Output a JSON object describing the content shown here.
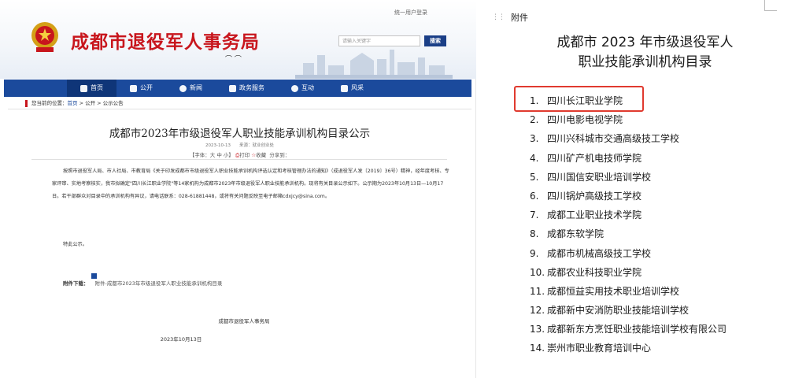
{
  "website": {
    "top_links": "统一用户登录",
    "site_title": "成都市退役军人事务局",
    "search": {
      "placeholder": "请输入关键字",
      "button": "搜索"
    },
    "nav": [
      {
        "label": "首页",
        "icon": "home-icon"
      },
      {
        "label": "公开",
        "icon": "calendar-icon"
      },
      {
        "label": "新闻",
        "icon": "globe-icon"
      },
      {
        "label": "政务服务",
        "icon": "person-icon"
      },
      {
        "label": "互动",
        "icon": "chat-icon"
      },
      {
        "label": "风采",
        "icon": "badge-icon"
      }
    ],
    "breadcrumb": {
      "prefix": "您当前的位置：",
      "home": "首页",
      "rest": " > 公开 > 公示公告"
    },
    "article": {
      "title": "成都市2023年市级退役军人职业技能承训机构目录公示",
      "meta": "2023-10-13　　来源：就业创业处",
      "tools": {
        "font": "【字体：大 中 小】",
        "print": "打印",
        "favorite": "收藏",
        "share": "分享到："
      },
      "paragraph_1": "按照市退役军人局、市人社局、市教育局《关于印发成都市市级退役军人职业技能承训机构评选认定和考核管理办法的通知》（成退役军人发〔2019〕36号）精神，经年度考核、专家评审、实地考察核实，我市拟确定\"四川长江职业学院\"等14家机构为成都市2023年市级退役军人职业技能承训机构。现将有关目录公示如下。公示期为2023年10月13日—10月17日。若干部群众对目录中的承训机构有异议，请电话联系：028-61881448，或将有关问题反映至电子邮箱cdxjcy@sina.com。",
      "paragraph_2": "特此公示。",
      "attachment_label": "附件下载：",
      "attachment_link": "附件-成都市2023年市级退役军人职业技能承训机构目录",
      "signature_org": "成都市退役军人事务局",
      "signature_date": "2023年10月13日"
    }
  },
  "document": {
    "label": "附件",
    "title_line1": "成都市 2023 年市级退役军人",
    "title_line2": "职业技能承训机构目录",
    "items": [
      {
        "num": "1.",
        "name": "四川长江职业学院"
      },
      {
        "num": "2.",
        "name": "四川电影电视学院"
      },
      {
        "num": "3.",
        "name": "四川兴科城市交通高级技工学校"
      },
      {
        "num": "4.",
        "name": "四川矿产机电技师学院"
      },
      {
        "num": "5.",
        "name": "四川国信安职业培训学校"
      },
      {
        "num": "6.",
        "name": "四川锅炉高级技工学校"
      },
      {
        "num": "7.",
        "name": "成都工业职业技术学院"
      },
      {
        "num": "8.",
        "name": "成都东软学院"
      },
      {
        "num": "9.",
        "name": "成都市机械高级技工学校"
      },
      {
        "num": "10.",
        "name": "成都农业科技职业学院"
      },
      {
        "num": "11.",
        "name": "成都恒益实用技术职业培训学校"
      },
      {
        "num": "12.",
        "name": "成都新中安消防职业技能培训学校"
      },
      {
        "num": "13.",
        "name": "成都新东方烹饪职业技能培训学校有限公司"
      },
      {
        "num": "14.",
        "name": "崇州市职业教育培训中心"
      }
    ],
    "highlight_color": "#e03a2f"
  }
}
